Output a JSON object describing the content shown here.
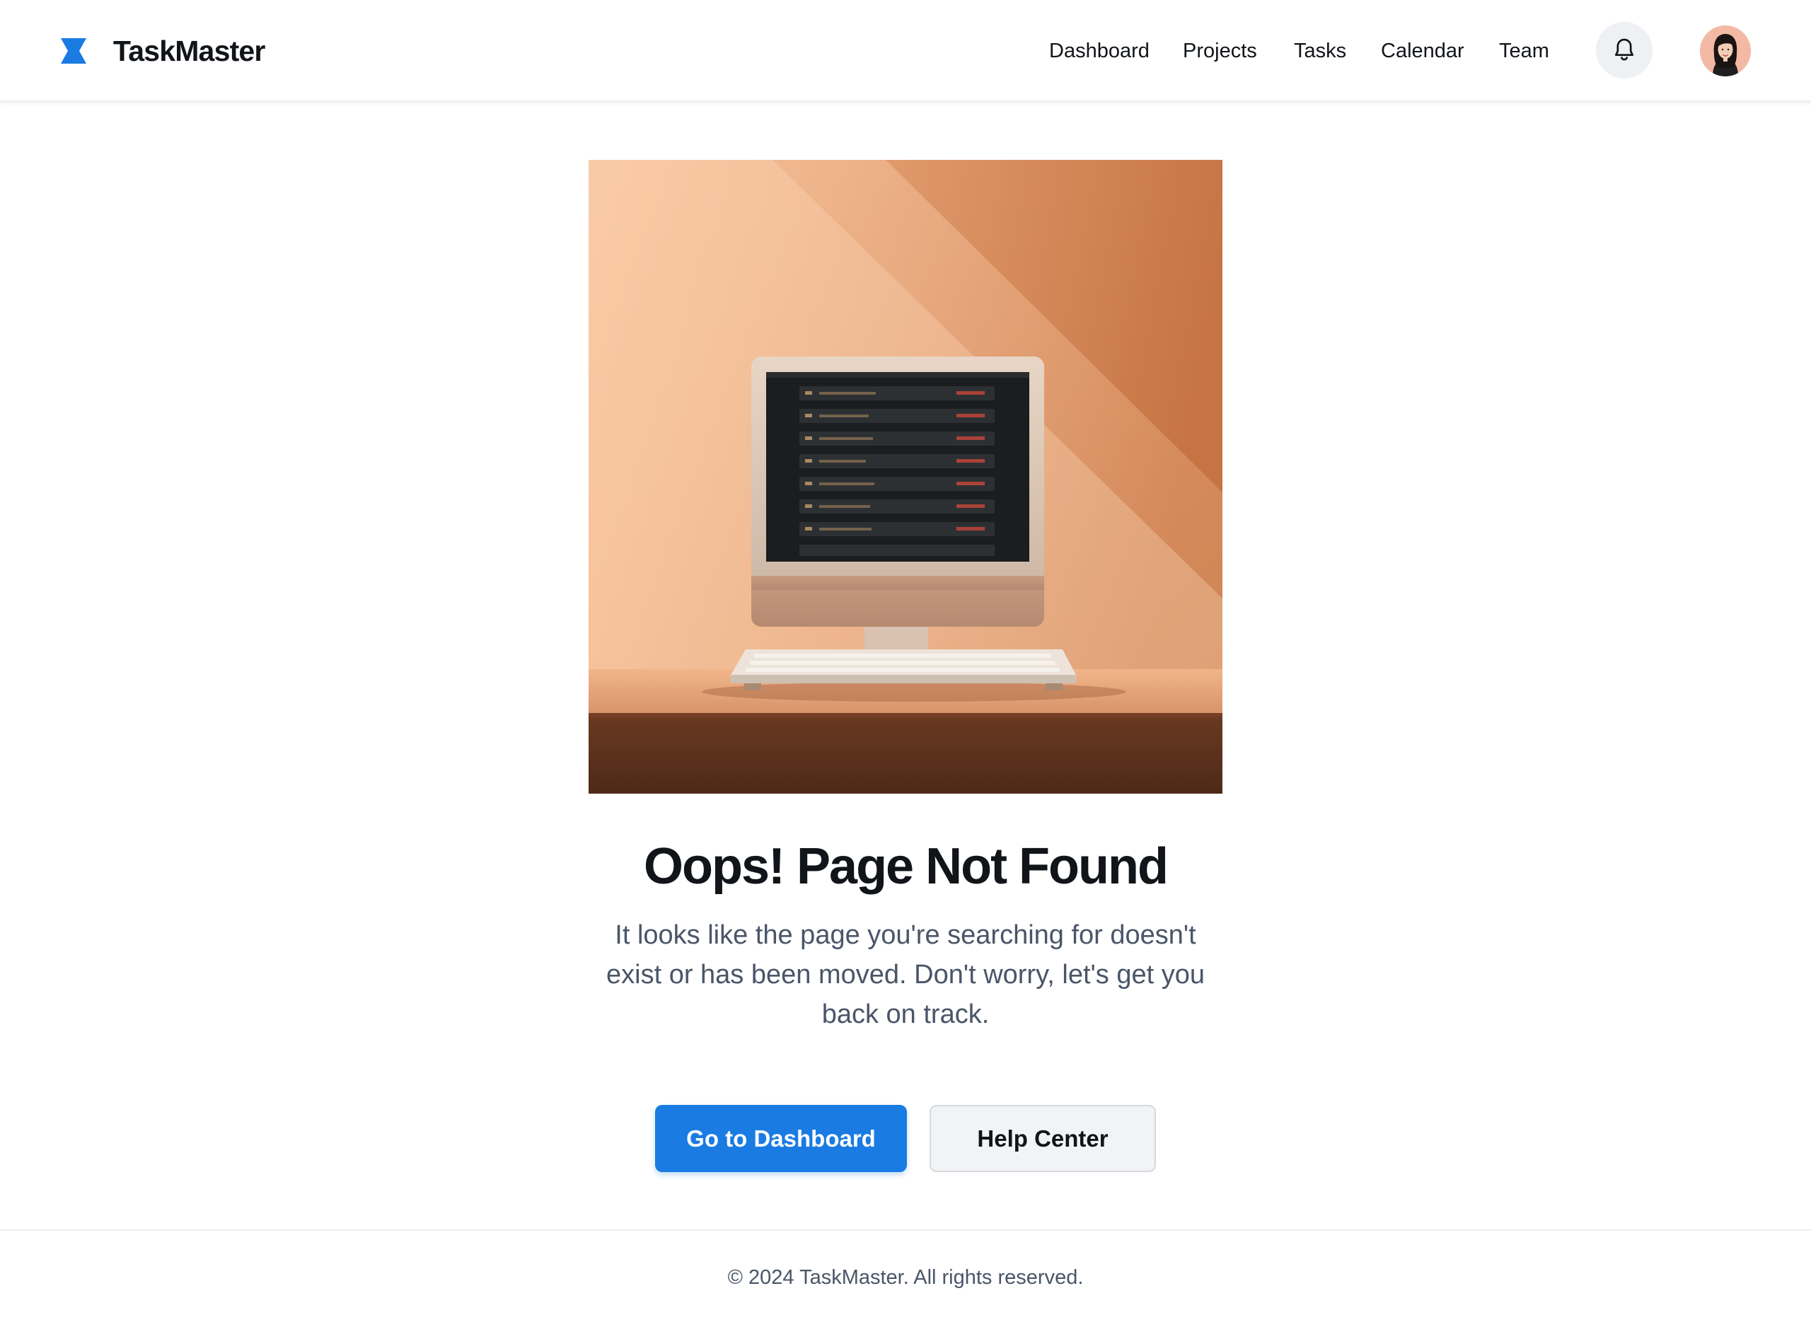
{
  "app": {
    "brand": "TaskMaster",
    "accent_color": "#1a7be3"
  },
  "header": {
    "logo_icon": "hourglass-logo-icon",
    "nav": [
      {
        "label": "Dashboard"
      },
      {
        "label": "Projects"
      },
      {
        "label": "Tasks"
      },
      {
        "label": "Calendar"
      },
      {
        "label": "Team"
      }
    ],
    "notification_icon": "bell-icon",
    "avatar_icon": "user-avatar"
  },
  "main": {
    "illustration": "desktop-computer-illustration",
    "title": "Oops! Page Not Found",
    "description": "It looks like the page you're searching for doesn't exist or has been moved. Don't worry, let's get you back on track.",
    "primary_button": "Go to Dashboard",
    "secondary_button": "Help Center"
  },
  "footer": {
    "copyright": "© 2024 TaskMaster. All rights reserved."
  }
}
